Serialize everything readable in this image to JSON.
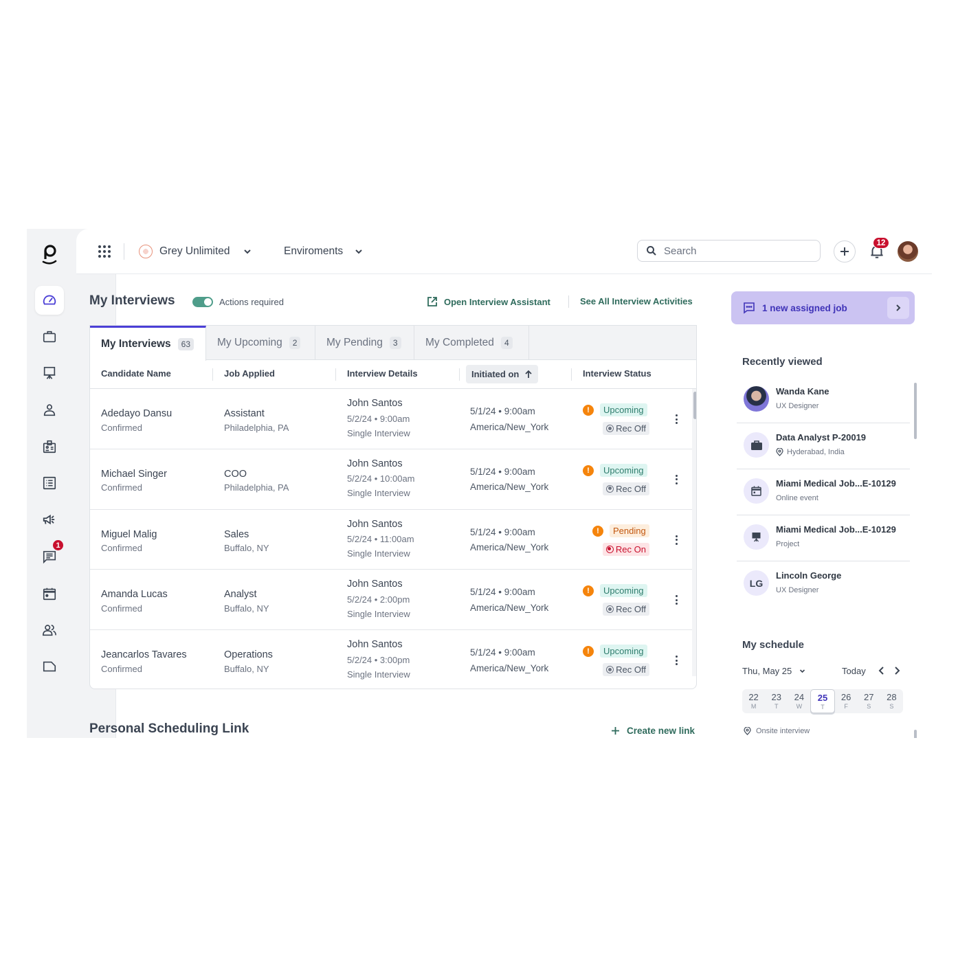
{
  "topbar": {
    "org_name": "Grey Unlimited",
    "environments_label": "Enviroments",
    "search_placeholder": "Search",
    "notifications_count": "12"
  },
  "sidebar": {
    "items": [
      {
        "name": "dashboard",
        "icon": "gauge-icon",
        "active": true
      },
      {
        "name": "jobs",
        "icon": "briefcase-icon"
      },
      {
        "name": "projects",
        "icon": "presentation-icon"
      },
      {
        "name": "candidates",
        "icon": "person-icon"
      },
      {
        "name": "badge",
        "icon": "id-badge-icon"
      },
      {
        "name": "lists",
        "icon": "list-icon"
      },
      {
        "name": "campaigns",
        "icon": "megaphone-icon"
      },
      {
        "name": "messages",
        "icon": "chat-icon",
        "badge": "1"
      },
      {
        "name": "calendar",
        "icon": "calendar-icon"
      },
      {
        "name": "users",
        "icon": "people-icon"
      },
      {
        "name": "notes",
        "icon": "note-icon"
      }
    ]
  },
  "main": {
    "title": "My Interviews",
    "toggle_label": "Actions required",
    "toggle_on": true,
    "open_assistant_label": "Open Interview Assistant",
    "see_all_label": "See All Interview Activities",
    "tabs": [
      {
        "label": "My Interviews",
        "count": "63",
        "active": true
      },
      {
        "label": "My Upcoming",
        "count": "2"
      },
      {
        "label": "My Pending",
        "count": "3"
      },
      {
        "label": "My Completed",
        "count": "4"
      }
    ],
    "columns": [
      "Candidate Name",
      "Job Applied",
      "Interview Details",
      "Initiated on",
      "Interview Status"
    ],
    "rows": [
      {
        "name": "Adedayo Dansu",
        "name_status": "Confirmed",
        "job": "Assistant",
        "location": "Philadelphia, PA",
        "interviewer": "John Santos",
        "interview_time": "5/2/24 • 9:00am",
        "interview_type": "Single Interview",
        "initiated": "5/1/24 • 9:00am",
        "timezone": "America/New_York",
        "status": "Upcoming",
        "status_kind": "upcoming",
        "rec": "Rec Off",
        "rec_kind": "off"
      },
      {
        "name": "Michael Singer",
        "name_status": "Confirmed",
        "job": "COO",
        "location": "Philadelphia, PA",
        "interviewer": "John Santos",
        "interview_time": "5/2/24 • 10:00am",
        "interview_type": "Single Interview",
        "initiated": "5/1/24 • 9:00am",
        "timezone": "America/New_York",
        "status": "Upcoming",
        "status_kind": "upcoming",
        "rec": "Rec Off",
        "rec_kind": "off"
      },
      {
        "name": "Miguel Malig",
        "name_status": "Confirmed",
        "job": "Sales",
        "location": "Buffalo, NY",
        "interviewer": "John Santos",
        "interview_time": "5/2/24 • 11:00am",
        "interview_type": "Single Interview",
        "initiated": "5/1/24 • 9:00am",
        "timezone": "America/New_York",
        "status": "Pending",
        "status_kind": "pending",
        "rec": "Rec On",
        "rec_kind": "on"
      },
      {
        "name": "Amanda Lucas",
        "name_status": "Confirmed",
        "job": "Analyst",
        "location": "Buffalo, NY",
        "interviewer": "John Santos",
        "interview_time": "5/2/24 • 2:00pm",
        "interview_type": "Single Interview",
        "initiated": "5/1/24 • 9:00am",
        "timezone": "America/New_York",
        "status": "Upcoming",
        "status_kind": "upcoming",
        "rec": "Rec Off",
        "rec_kind": "off"
      },
      {
        "name": "Jeancarlos Tavares",
        "name_status": "Confirmed",
        "job": "Operations",
        "location": "Buffalo, NY",
        "interviewer": "John Santos",
        "interview_time": "5/2/24 • 3:00pm",
        "interview_type": "Single Interview",
        "initiated": "5/1/24 • 9:00am",
        "timezone": "America/New_York",
        "status": "Upcoming",
        "status_kind": "upcoming",
        "rec": "Rec Off",
        "rec_kind": "off"
      }
    ],
    "scheduling_title": "Personal Scheduling Link",
    "create_link_label": "Create new link"
  },
  "right": {
    "assigned_label": "1 new assigned job",
    "recently_viewed_title": "Recently viewed",
    "recently_viewed": [
      {
        "title": "Wanda Kane",
        "subtitle": "UX Designer",
        "icon": "photo"
      },
      {
        "title": "Data Analyst P-20019",
        "subtitle": "Hyderabad, India",
        "icon": "briefcase",
        "has_pin": true
      },
      {
        "title": "Miami Medical Job...E-10129",
        "subtitle": "Online event",
        "icon": "calendar"
      },
      {
        "title": "Miami Medical Job...E-10129",
        "subtitle": "Project",
        "icon": "presentation"
      },
      {
        "title": "Lincoln George",
        "subtitle": "UX Designer",
        "icon": "initials",
        "initials": "LG"
      }
    ],
    "schedule_title": "My schedule",
    "schedule_date": "Thu, May 25",
    "today_label": "Today",
    "week": [
      {
        "num": "22",
        "letter": "M"
      },
      {
        "num": "23",
        "letter": "T"
      },
      {
        "num": "24",
        "letter": "W"
      },
      {
        "num": "25",
        "letter": "T",
        "selected": true
      },
      {
        "num": "26",
        "letter": "F"
      },
      {
        "num": "27",
        "letter": "S"
      },
      {
        "num": "28",
        "letter": "S"
      }
    ],
    "event_label": "Onsite interview"
  }
}
